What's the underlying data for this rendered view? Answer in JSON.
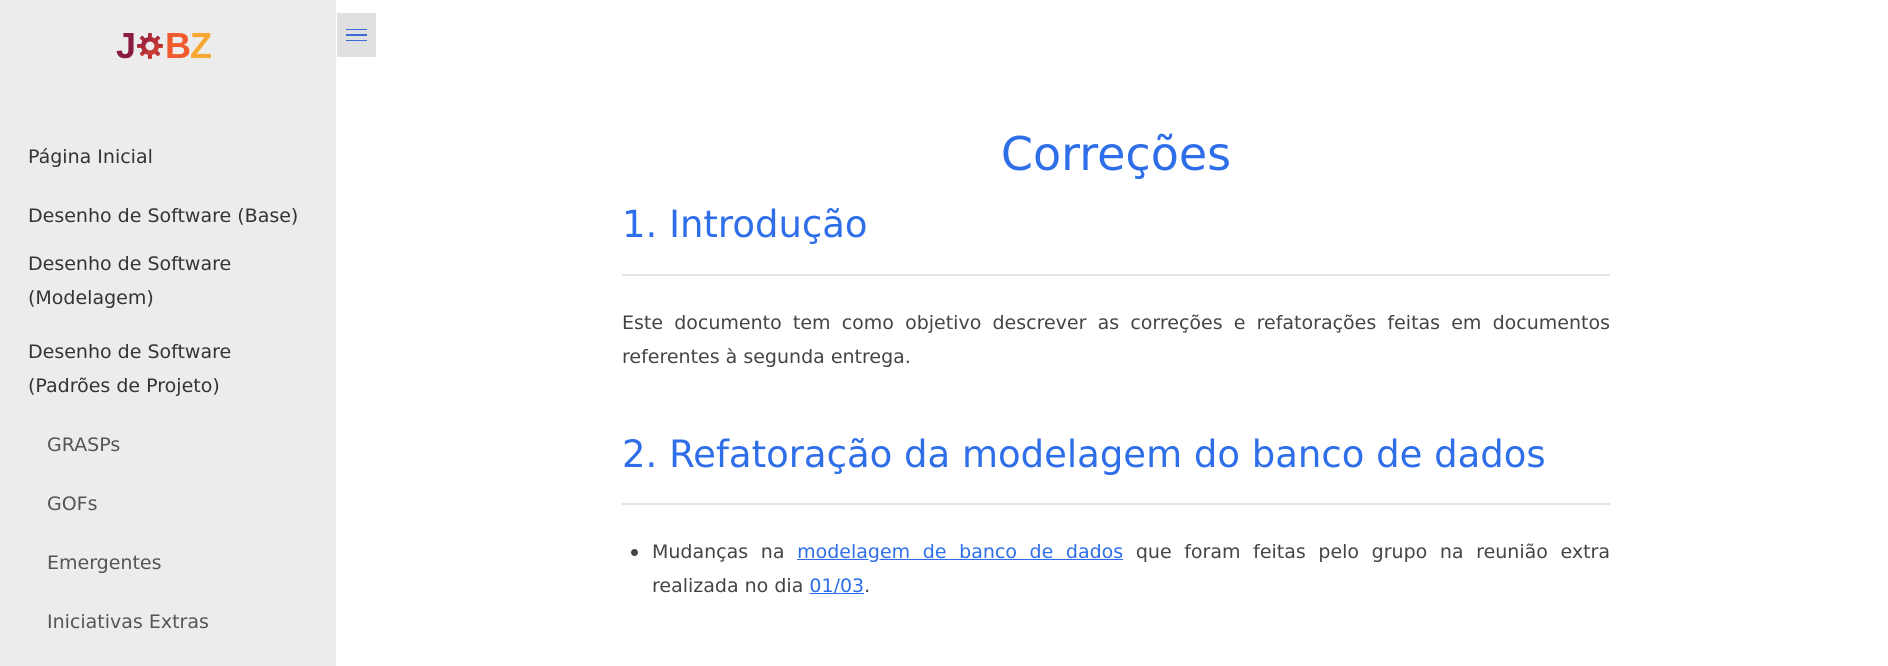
{
  "logo": {
    "letters": [
      "J",
      "B",
      "Z"
    ]
  },
  "sidebar": {
    "items": [
      {
        "label": "Página Inicial"
      },
      {
        "label": "Desenho de Software (Base)"
      },
      {
        "label": "Desenho de Software (Modelagem)"
      },
      {
        "label": "Desenho de Software (Padrões de Projeto)"
      }
    ],
    "subitems": [
      {
        "label": "GRASPs"
      },
      {
        "label": "GOFs"
      },
      {
        "label": "Emergentes"
      },
      {
        "label": "Iniciativas Extras"
      }
    ]
  },
  "main": {
    "title": "Correções",
    "sections": [
      {
        "heading": "1. Introdução",
        "text": "Este documento tem como objetivo descrever as correções e refatorações feitas em documentos referentes à segunda entrega."
      },
      {
        "heading": "2. Refatoração da modelagem do banco de dados",
        "bullet": {
          "prefix": "Mudanças na",
          "link_text": "modelagem de banco de dados",
          "middle": "que foram feitas pelo grupo na reunião extra realizada no dia",
          "date_link": "01/03",
          "suffix": "."
        }
      }
    ]
  },
  "colors": {
    "accent": "#2e6ee8",
    "sidebar_bg": "#ececec",
    "logo_dark": "#8a1c3f",
    "logo_orange": "#f15a2c",
    "logo_yellow": "#f7a833"
  }
}
